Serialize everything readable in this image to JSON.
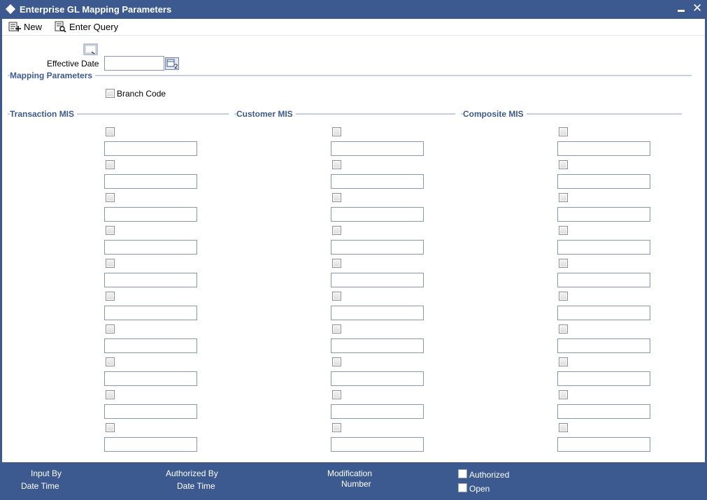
{
  "window": {
    "title": "Enterprise GL Mapping Parameters"
  },
  "toolbar": {
    "new_label": "New",
    "enter_query_label": "Enter Query"
  },
  "header": {
    "effective_date_label": "Effective Date",
    "effective_date_value": ""
  },
  "mapping_parameters": {
    "title": "Mapping Parameters",
    "branch_code_label": "Branch Code"
  },
  "transaction_mis": {
    "title": "Transaction MIS"
  },
  "customer_mis": {
    "title": "Customer MIS"
  },
  "composite_mis": {
    "title": "Composite MIS"
  },
  "footer": {
    "input_by_label": "Input By",
    "date_time_label_1": "Date Time",
    "authorized_by_label": "Authorized By",
    "date_time_label_2": "Date Time",
    "modification_label": "Modification",
    "number_label": "Number",
    "authorized_label": "Authorized",
    "open_label": "Open"
  },
  "colors": {
    "brand": "#3c5a8f",
    "section_line": "#c5d1e3"
  }
}
